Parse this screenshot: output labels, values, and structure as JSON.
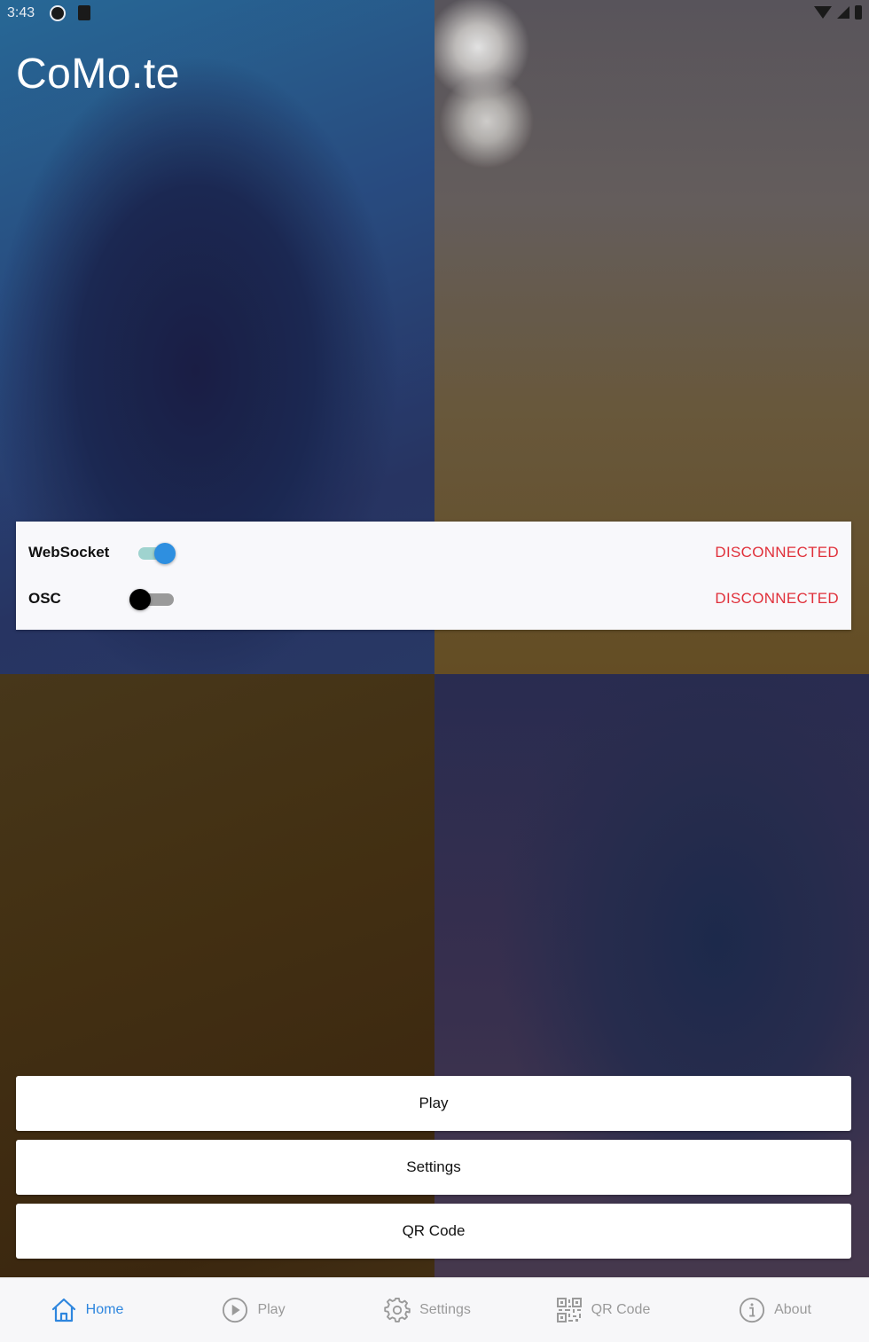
{
  "status_bar": {
    "time": "3:43"
  },
  "app": {
    "title": "CoMo.te"
  },
  "connections": [
    {
      "label": "WebSocket",
      "enabled": true,
      "status": "DISCONNECTED"
    },
    {
      "label": "OSC",
      "enabled": false,
      "status": "DISCONNECTED"
    }
  ],
  "actions": {
    "play": "Play",
    "settings": "Settings",
    "qr_code": "QR Code"
  },
  "nav": {
    "items": [
      {
        "label": "Home",
        "icon": "home-icon",
        "active": true
      },
      {
        "label": "Play",
        "icon": "play-circle-icon",
        "active": false
      },
      {
        "label": "Settings",
        "icon": "gear-icon",
        "active": false
      },
      {
        "label": "QR Code",
        "icon": "qr-code-icon",
        "active": false
      },
      {
        "label": "About",
        "icon": "info-icon",
        "active": false
      }
    ]
  },
  "colors": {
    "accent": "#2e86de",
    "status_disconnected": "#e0303a",
    "toggle_on_thumb": "#2e8fe0",
    "toggle_on_track": "#9fd3cf"
  }
}
